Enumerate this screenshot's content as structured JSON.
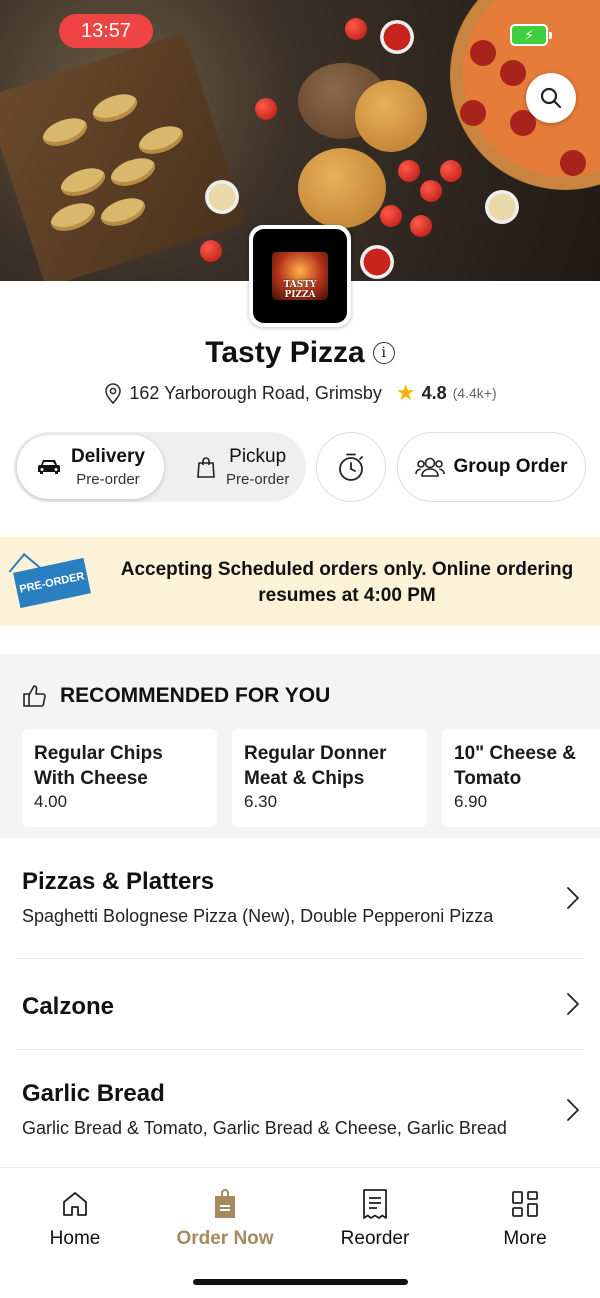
{
  "status_bar": {
    "time": "13:57",
    "battery_icon": "battery-charging-icon"
  },
  "restaurant": {
    "name": "Tasty Pizza",
    "logo_text": "TASTY PIZZA",
    "address": "162 Yarborough Road, Grimsby",
    "rating": "4.8",
    "rating_count": "(4.4k+)"
  },
  "order_mode": {
    "delivery_label": "Delivery",
    "delivery_sub": "Pre-order",
    "pickup_label": "Pickup",
    "pickup_sub": "Pre-order",
    "selected": "Delivery"
  },
  "group_order_label": "Group Order",
  "banner": {
    "tag": "PRE-ORDER",
    "message": "Accepting Scheduled orders only. Online ordering resumes at 4:00 PM"
  },
  "recommended": {
    "heading": "RECOMMENDED FOR YOU",
    "items": [
      {
        "name": "Regular Chips With Cheese",
        "price": "4.00"
      },
      {
        "name": "Regular Donner Meat & Chips",
        "price": "6.30"
      },
      {
        "name": "10\" Cheese & Tomato",
        "price": "6.90"
      }
    ]
  },
  "categories": [
    {
      "name": "Pizzas & Platters",
      "desc": "Spaghetti Bolognese Pizza (New), Double Pepperoni Pizza"
    },
    {
      "name": "Calzone",
      "desc": ""
    },
    {
      "name": "Garlic Bread",
      "desc": "Garlic Bread & Tomato, Garlic Bread & Cheese, Garlic Bread"
    }
  ],
  "tabs": [
    {
      "label": "Home",
      "icon": "home-icon"
    },
    {
      "label": "Order Now",
      "icon": "order-bag-icon"
    },
    {
      "label": "Reorder",
      "icon": "receipt-icon"
    },
    {
      "label": "More",
      "icon": "grid-icon"
    }
  ],
  "colors": {
    "accent": "#a48a5e",
    "banner_bg": "#fcf2d8",
    "time_pill": "#ef4444",
    "star": "#f6b400"
  }
}
